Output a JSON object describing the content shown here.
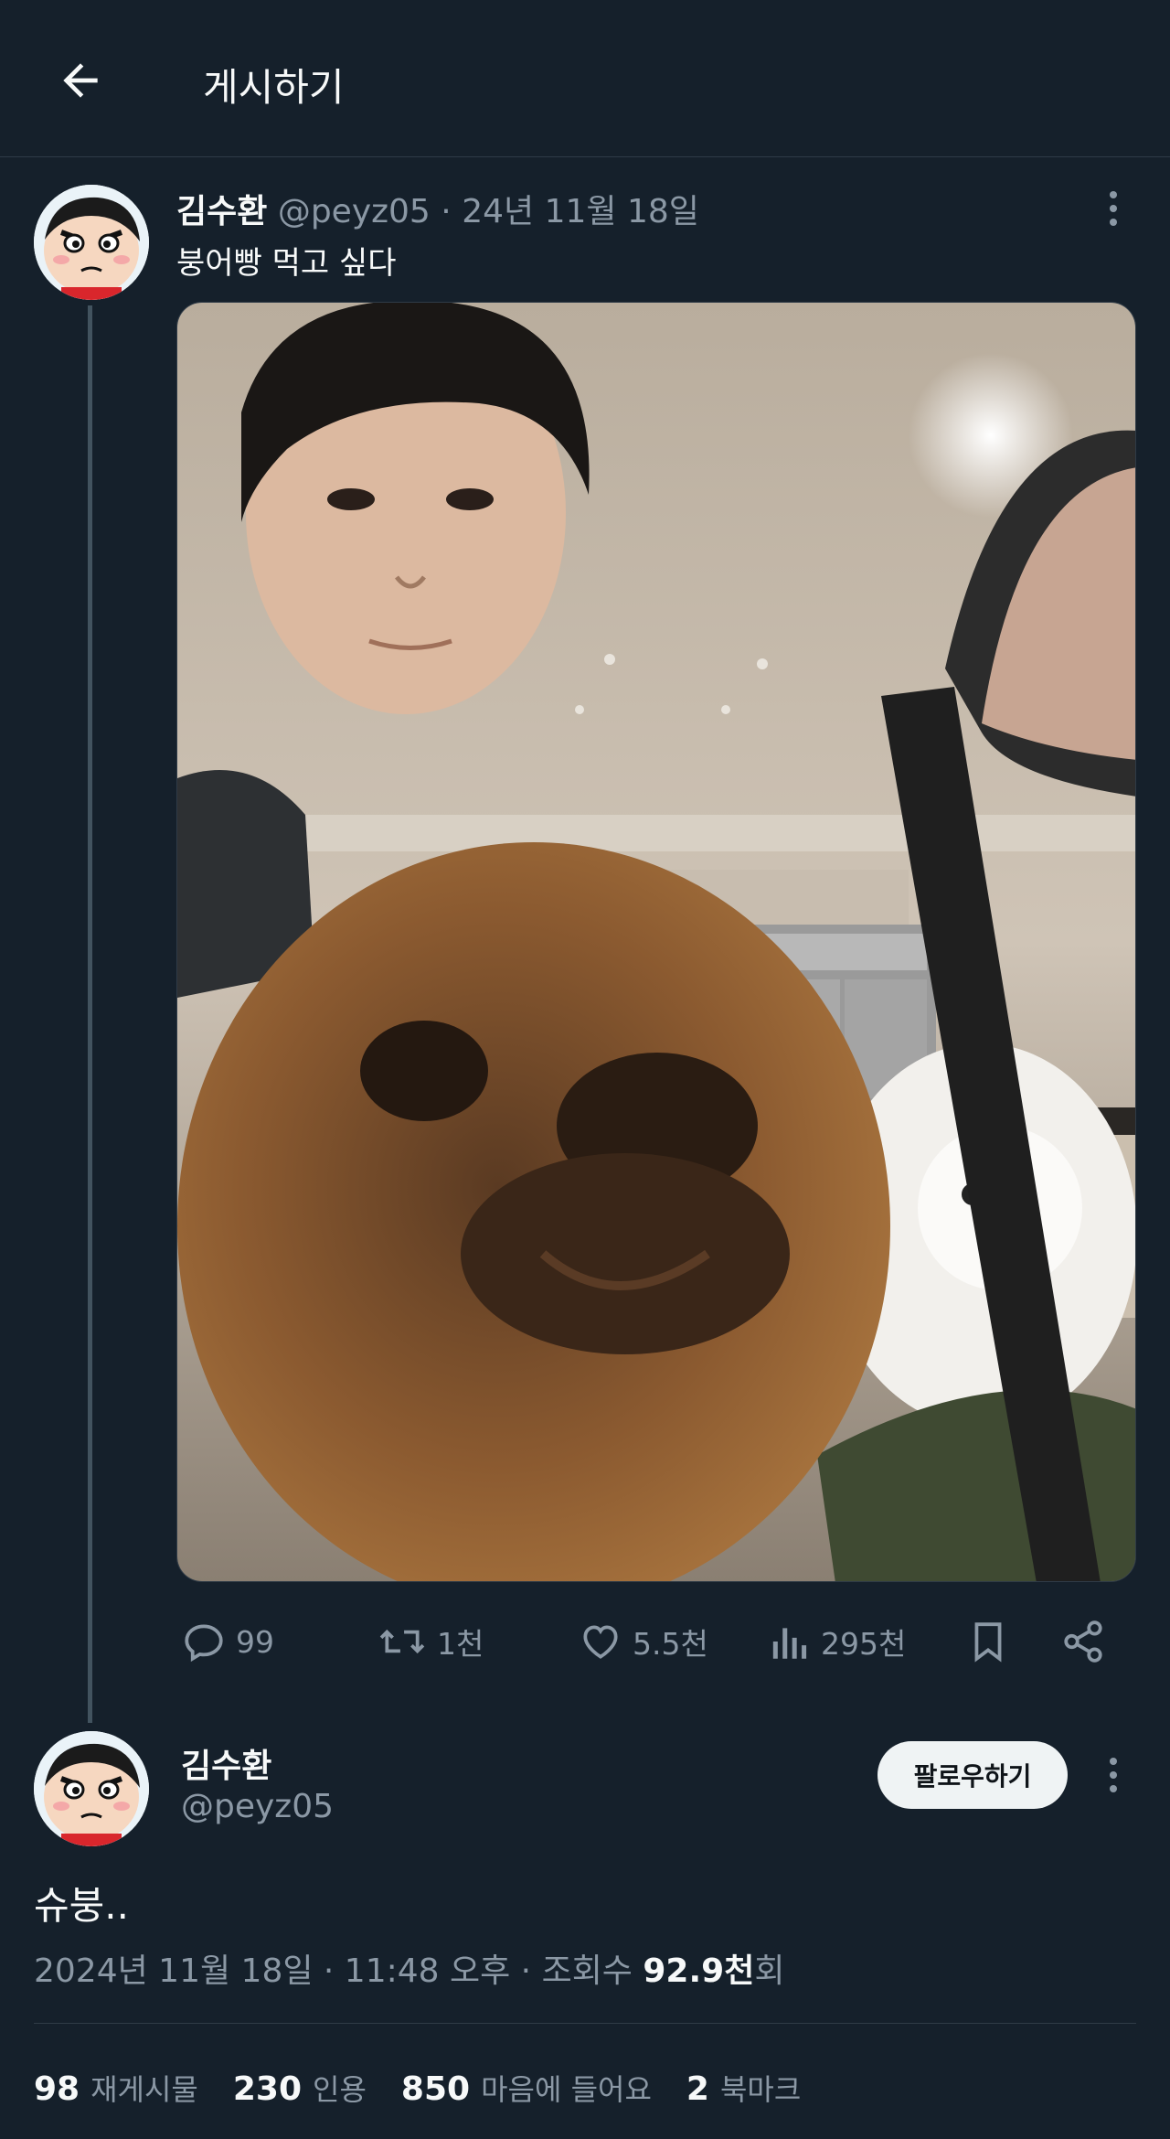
{
  "header": {
    "title": "게시하기"
  },
  "parent_post": {
    "author_name": "김수환",
    "handle": "@peyz05",
    "separator": "·",
    "date": "24년 11월 18일",
    "text": "붕어빵 먹고 싶다",
    "actions": {
      "replies": "99",
      "reposts": "1천",
      "likes": "5.5천",
      "views": "295천"
    }
  },
  "main_post": {
    "author_name": "김수환",
    "handle": "@peyz05",
    "follow_label": "팔로우하기",
    "text": "슈붕..",
    "meta_prefix": "2024년 11월 18일 · 11:48 오후 · 조회수 ",
    "views_count": "92.9천",
    "views_suffix": "회",
    "stats": [
      {
        "num": "98",
        "label": "재게시물"
      },
      {
        "num": "230",
        "label": "인용"
      },
      {
        "num": "850",
        "label": "마음에 들어요"
      },
      {
        "num": "2",
        "label": "북마크"
      }
    ]
  },
  "colors": {
    "background": "#15202b",
    "muted": "#8b98a5",
    "text": "#f7f9f9"
  }
}
